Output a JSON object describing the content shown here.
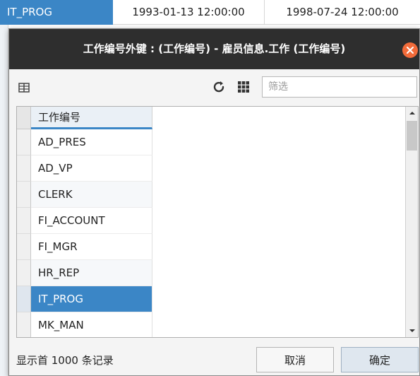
{
  "background_row": {
    "cells": [
      "IT_PROG",
      "1993-01-13 12:00:00",
      "1998-07-24 12:00:00"
    ]
  },
  "dialog": {
    "title": "工作编号外键 : (工作编号) - 雇员信息.工作 (工作编号)",
    "toolbar": {
      "filter_placeholder": "筛选",
      "filter_value": ""
    },
    "grid": {
      "column_header": "工作编号",
      "rows": [
        "AD_PRES",
        "AD_VP",
        "CLERK",
        "FI_ACCOUNT",
        "FI_MGR",
        "HR_REP",
        "IT_PROG",
        "MK_MAN"
      ],
      "selected_row": "IT_PROG"
    },
    "footer": {
      "status": "显示首 1000 条记录",
      "cancel_label": "取消",
      "ok_label": "确定"
    }
  },
  "colors": {
    "accent": "#3b86c6",
    "titlebar": "#2e2e2e",
    "close": "#f26b3a"
  },
  "icons": {
    "columns": "columns-icon",
    "refresh": "refresh-icon",
    "grid": "grid-view-icon",
    "close": "close-icon"
  }
}
